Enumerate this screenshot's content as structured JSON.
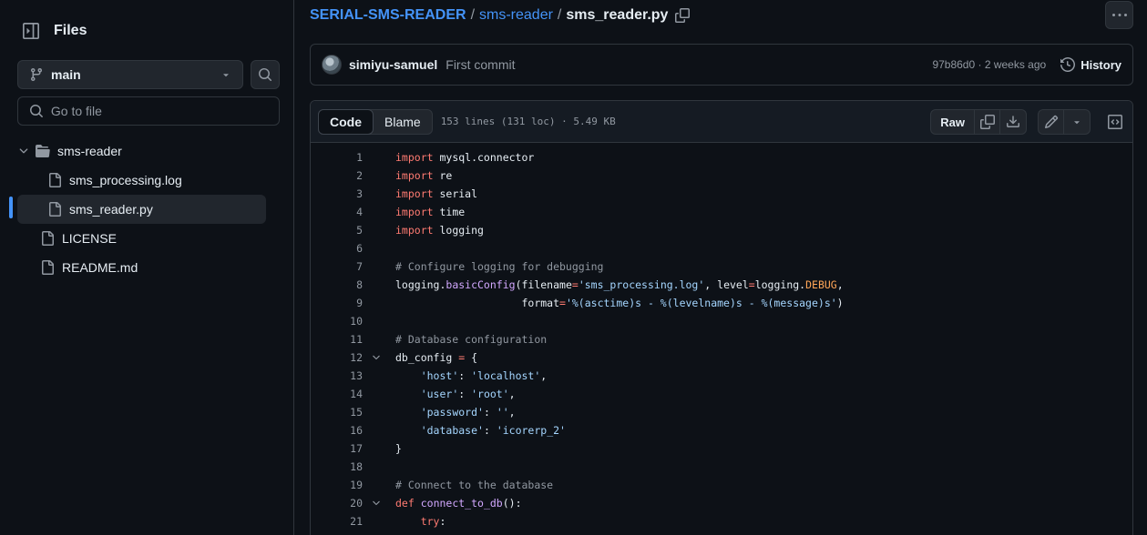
{
  "sidebar": {
    "title": "Files",
    "branch": "main",
    "goto_placeholder": "Go to file",
    "tree": [
      {
        "name": "sms-reader",
        "type": "folder"
      },
      {
        "name": "sms_processing.log",
        "type": "file"
      },
      {
        "name": "sms_reader.py",
        "type": "file",
        "selected": true
      },
      {
        "name": "LICENSE",
        "type": "file"
      },
      {
        "name": "README.md",
        "type": "file"
      }
    ]
  },
  "breadcrumb": {
    "repo": "SERIAL-SMS-READER",
    "sep1": "/",
    "folder": "sms-reader",
    "sep2": "/",
    "file": "sms_reader.py"
  },
  "commit": {
    "author": "simiyu-samuel",
    "message": "First commit",
    "meta": "97b86d0 · 2 weeks ago",
    "history_label": "History"
  },
  "file_header": {
    "tabs": [
      "Code",
      "Blame"
    ],
    "meta": "153 lines (131 loc) · 5.49 KB",
    "raw_label": "Raw"
  },
  "code": {
    "line_numbers": [
      "1",
      "2",
      "3",
      "4",
      "5",
      "6",
      "7",
      "8",
      "9",
      "10",
      "11",
      "12",
      "13",
      "14",
      "15",
      "16",
      "17",
      "18",
      "19",
      "20",
      "21"
    ],
    "lines": [
      "import mysql.connector",
      "import re",
      "import serial",
      "import time",
      "import logging",
      "",
      "# Configure logging for debugging",
      "logging.basicConfig(filename='sms_processing.log', level=logging.DEBUG,",
      "                    format='%(asctime)s - %(levelname)s - %(message)s')",
      "",
      "# Database configuration",
      "db_config = {",
      "    'host': 'localhost',",
      "    'user': 'root',",
      "    'password': '',",
      "    'database': 'icorerp_2'",
      "}",
      "",
      "# Connect to the database",
      "def connect_to_db():",
      "    try:"
    ]
  },
  "colors": {
    "accent": "#4493f8",
    "keyword": "#ff7b72",
    "string": "#a5d6ff",
    "comment": "#9198a1",
    "function": "#d2a8ff",
    "constant": "#ffa657",
    "background": "#0d1117"
  },
  "icons": [
    "sidebar-collapse-icon",
    "branch-icon",
    "caret-down-icon",
    "search-icon",
    "chevron-down-icon",
    "folder-icon",
    "file-icon",
    "copy-icon",
    "kebab-icon",
    "history-icon",
    "download-icon",
    "pencil-icon",
    "symbols-icon"
  ]
}
